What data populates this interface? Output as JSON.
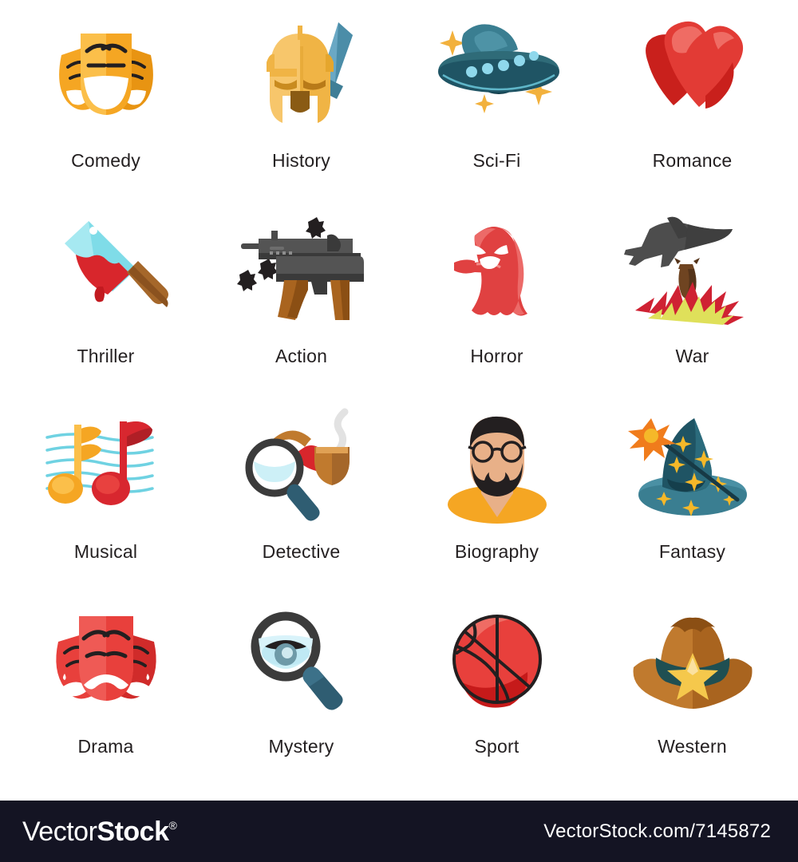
{
  "page": {
    "background": "#ffffff",
    "label_color": "#231f20"
  },
  "grid": {
    "columns": 4,
    "rows": 4,
    "items": [
      {
        "id": "comedy",
        "label": "Comedy",
        "icon": "comedy-masks-icon",
        "colors": [
          "#f5a623",
          "#fbbf4a",
          "#ffffff",
          "#e89412"
        ]
      },
      {
        "id": "history",
        "label": "History",
        "icon": "spartan-helmet-sword-icon",
        "colors": [
          "#f0b445",
          "#f7c66b",
          "#6aa8c4",
          "#3f7e96"
        ]
      },
      {
        "id": "scifi",
        "label": "Sci-Fi",
        "icon": "ufo-icon",
        "colors": [
          "#1f4f5e",
          "#2f6b78",
          "#8fd8ec",
          "#f2b13d"
        ]
      },
      {
        "id": "romance",
        "label": "Romance",
        "icon": "two-hearts-icon",
        "colors": [
          "#e23b35",
          "#c9201c",
          "#ef6c64"
        ]
      },
      {
        "id": "thriller",
        "label": "Thriller",
        "icon": "bloody-cleaver-icon",
        "colors": [
          "#7fdce8",
          "#a6e9f1",
          "#a5672a",
          "#d8262c"
        ]
      },
      {
        "id": "action",
        "label": "Action",
        "icon": "machine-gun-icon",
        "colors": [
          "#4a4a4a",
          "#3a3a3a",
          "#a9641f",
          "#231f20"
        ]
      },
      {
        "id": "horror",
        "label": "Horror",
        "icon": "angry-ghost-icon",
        "colors": [
          "#e04141",
          "#ec6a68",
          "#ffffff"
        ]
      },
      {
        "id": "war",
        "label": "War",
        "icon": "bomber-plane-bomb-icon",
        "colors": [
          "#4d4d4d",
          "#6f4421",
          "#cf2233",
          "#dfe05a"
        ]
      },
      {
        "id": "musical",
        "label": "Musical",
        "icon": "music-notes-icon",
        "colors": [
          "#f5a623",
          "#fbbf4a",
          "#d8272f",
          "#6fd2e2"
        ]
      },
      {
        "id": "detective",
        "label": "Detective",
        "icon": "magnifier-pipe-icon",
        "colors": [
          "#3b3b3b",
          "#cdf0f7",
          "#2f5d72",
          "#c07a2e",
          "#d8262c"
        ]
      },
      {
        "id": "biography",
        "label": "Biography",
        "icon": "bearded-man-icon",
        "colors": [
          "#231f20",
          "#e8b088",
          "#f5a623"
        ]
      },
      {
        "id": "fantasy",
        "label": "Fantasy",
        "icon": "wizard-hat-wand-icon",
        "colors": [
          "#1f5464",
          "#3a7e91",
          "#f5b829",
          "#f07c1c"
        ]
      },
      {
        "id": "drama",
        "label": "Drama",
        "icon": "tragedy-masks-icon",
        "colors": [
          "#e8403c",
          "#ef5a55",
          "#ffffff",
          "#d02b2a"
        ]
      },
      {
        "id": "mystery",
        "label": "Mystery",
        "icon": "magnifier-eye-icon",
        "colors": [
          "#3b3b3b",
          "#cdf0f7",
          "#2f5d72",
          "#8fd8ec"
        ]
      },
      {
        "id": "sport",
        "label": "Sport",
        "icon": "basketball-icon",
        "colors": [
          "#e8403c",
          "#c61a1a",
          "#231f20"
        ]
      },
      {
        "id": "western",
        "label": "Western",
        "icon": "cowboy-hat-icon",
        "colors": [
          "#c07a2e",
          "#a9641f",
          "#1f4f52",
          "#f5c84c"
        ]
      }
    ]
  },
  "footer": {
    "background": "#141423",
    "logo_part_one": "Vector",
    "logo_part_two": "Stock",
    "logo_registered": "®",
    "site_url": "VectorStock.com/7145872"
  }
}
